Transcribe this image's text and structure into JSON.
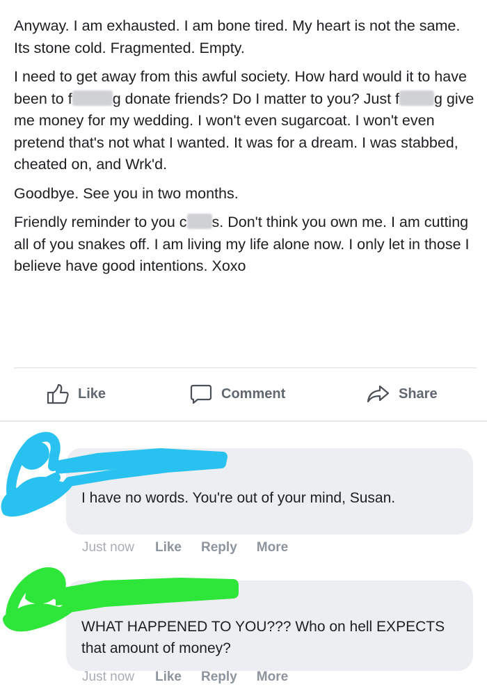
{
  "post": {
    "paragraphs": [
      {
        "segments": [
          {
            "text": "Anyway. I am exhausted. I am bone tired. My heart is not the same. Its stone cold. Fragmented. Empty."
          }
        ]
      },
      {
        "segments": [
          {
            "text": "I need to get away from this awful society. How hard would it to have been to f"
          },
          {
            "censor": true,
            "width": 58
          },
          {
            "text": "g donate friends? Do I matter to you? Just f"
          },
          {
            "censor": true,
            "width": 50
          },
          {
            "text": "g give me money for my wedding. I won't even sugarcoat. I won't even pretend that's not what I wanted. It was for a dream. I was stabbed, cheated on, and Wrk'd."
          }
        ]
      },
      {
        "segments": [
          {
            "text": "Goodbye. See you in two months."
          }
        ]
      },
      {
        "segments": [
          {
            "text": "Friendly reminder to you c"
          },
          {
            "censor": true,
            "width": 36
          },
          {
            "text": "s. Don't think you own me. I am cutting all of you snakes off. I am living my life alone now. I only let in those I believe have good intentions. Xoxo"
          }
        ]
      }
    ]
  },
  "actions": {
    "like": "Like",
    "comment": "Comment",
    "share": "Share",
    "like_icon": "thumbs-up-icon",
    "comment_icon": "speech-bubble-icon",
    "share_icon": "share-arrow-icon"
  },
  "comments": [
    {
      "author_redaction_color": "#29c2f0",
      "text": "I have no words. You're out of your mind, Susan.",
      "timestamp": "Just now",
      "like": "Like",
      "reply": "Reply",
      "more": "More"
    },
    {
      "author_redaction_color": "#2ee53a",
      "text": "WHAT HAPPENED TO YOU??? Who on hell EXPECTS that amount of money?",
      "timestamp": "Just now",
      "like": "Like",
      "reply": "Reply",
      "more": "More"
    }
  ],
  "colors": {
    "text": "#1c1e21",
    "secondary": "#606770",
    "bubble": "#edeef1"
  }
}
